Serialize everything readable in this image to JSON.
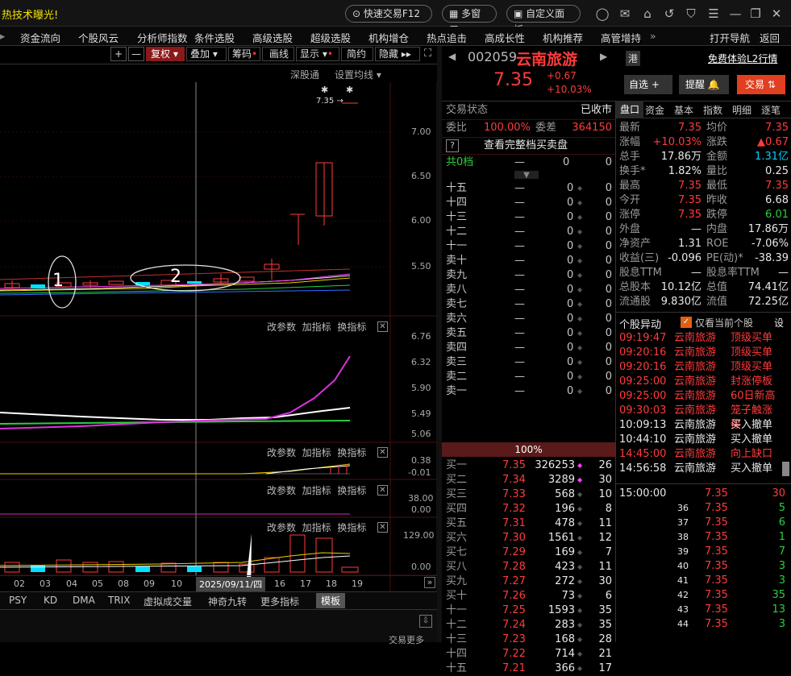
{
  "topbar": {
    "title": "热技术曝光!",
    "buttons": [
      "快速交易F12",
      "多窗口",
      "自定义面板"
    ]
  },
  "menu": [
    "资金流向",
    "个股风云",
    "分析师指数",
    "条件选股",
    "高级选股",
    "超级选股",
    "机构增仓",
    "热点追击",
    "高成长性",
    "机构推荐",
    "高管增持",
    "»",
    "打开导航",
    "返回"
  ],
  "chart_toolbar": [
    "+",
    "—",
    "复权",
    "叠加",
    "筹码",
    "画线",
    "显示",
    "简约",
    "隐藏"
  ],
  "chart_sub": {
    "left": "深股通",
    "right": "设置均线"
  },
  "main_price_marker": "7.35",
  "main_y": [
    "7.00",
    "6.50",
    "6.00",
    "5.50"
  ],
  "annotations": {
    "a1": "1",
    "a2": "2"
  },
  "panel_tools": {
    "change": "改参数",
    "add": "加指标",
    "swap": "换指标"
  },
  "panel2_y": [
    "6.76",
    "6.32",
    "5.90",
    "5.49",
    "5.06"
  ],
  "panel3_y": [
    "0.38",
    "-0.01"
  ],
  "panel4_y": [
    "38.00",
    "0.00"
  ],
  "panel5_y": [
    "129.00",
    "0.00"
  ],
  "x_labels": [
    "02",
    "03",
    "04",
    "05",
    "08",
    "09",
    "10",
    "16",
    "17",
    "18",
    "19"
  ],
  "x_date": "2025/09/11/四",
  "bottom_tabs": [
    "PSY",
    "KD",
    "DMA",
    "TRIX",
    "虚拟成交量",
    "神奇九转",
    "更多指标",
    "模板"
  ],
  "bottom_right": "交易更多",
  "stock": {
    "code": "002059",
    "name": "云南旅游",
    "price": "7.35",
    "change": "+0.67",
    "pct": "+10.03%",
    "tag": "港",
    "l2": "免费体验L2行情"
  },
  "actions": {
    "watch": "自选 +",
    "remind": "提醒",
    "trade": "交易"
  },
  "trade_state": {
    "label": "交易状态",
    "value": "已收市"
  },
  "weibi": {
    "label": "委比",
    "value": "100.00%",
    "label2": "委差",
    "value2": "364150"
  },
  "full_book": "查看完整档买卖盘",
  "gong": {
    "label": "共0档",
    "v1": "—",
    "v2": "0",
    "v3": "0"
  },
  "sell_levels": [
    [
      "十五",
      "—",
      "0",
      "0"
    ],
    [
      "十四",
      "—",
      "0",
      "0"
    ],
    [
      "十三",
      "—",
      "0",
      "0"
    ],
    [
      "十二",
      "—",
      "0",
      "0"
    ],
    [
      "十一",
      "—",
      "0",
      "0"
    ],
    [
      "卖十",
      "—",
      "0",
      "0"
    ],
    [
      "卖九",
      "—",
      "0",
      "0"
    ],
    [
      "卖八",
      "—",
      "0",
      "0"
    ],
    [
      "卖七",
      "—",
      "0",
      "0"
    ],
    [
      "卖六",
      "—",
      "0",
      "0"
    ],
    [
      "卖五",
      "—",
      "0",
      "0"
    ],
    [
      "卖四",
      "—",
      "0",
      "0"
    ],
    [
      "卖三",
      "—",
      "0",
      "0"
    ],
    [
      "卖二",
      "—",
      "0",
      "0"
    ],
    [
      "卖一",
      "—",
      "0",
      "0"
    ]
  ],
  "mid_bar": "100%",
  "buy_levels": [
    [
      "买一",
      "7.35",
      "326253",
      "26"
    ],
    [
      "买二",
      "7.34",
      "3289",
      "30"
    ],
    [
      "买三",
      "7.33",
      "568",
      "10"
    ],
    [
      "买四",
      "7.32",
      "196",
      "8"
    ],
    [
      "买五",
      "7.31",
      "478",
      "11"
    ],
    [
      "买六",
      "7.30",
      "1561",
      "12"
    ],
    [
      "买七",
      "7.29",
      "169",
      "7"
    ],
    [
      "买八",
      "7.28",
      "423",
      "11"
    ],
    [
      "买九",
      "7.27",
      "272",
      "30"
    ],
    [
      "买十",
      "7.26",
      "73",
      "6"
    ],
    [
      "十一",
      "7.25",
      "1593",
      "35"
    ],
    [
      "十二",
      "7.24",
      "283",
      "35"
    ],
    [
      "十三",
      "7.23",
      "168",
      "28"
    ],
    [
      "十四",
      "7.22",
      "714",
      "21"
    ],
    [
      "十五",
      "7.21",
      "366",
      "17"
    ]
  ],
  "tabs": [
    "盘口",
    "资金",
    "基本",
    "指数",
    "明细",
    "逐笔"
  ],
  "quote": [
    [
      "最新",
      "7.35",
      "均价",
      "7.35"
    ],
    [
      "涨幅",
      "+10.03%",
      "涨跌",
      "▲0.67"
    ],
    [
      "总手",
      "17.86万",
      "金额",
      "1.31亿"
    ],
    [
      "换手*",
      "1.82%",
      "量比",
      "0.25"
    ],
    [
      "最高",
      "7.35",
      "最低",
      "7.35"
    ],
    [
      "今开",
      "7.35",
      "昨收",
      "6.68"
    ],
    [
      "涨停",
      "7.35",
      "跌停",
      "6.01"
    ],
    [
      "外盘",
      "—",
      "内盘",
      "17.86万"
    ],
    [
      "净资产",
      "1.31",
      "ROE",
      "-7.06%"
    ],
    [
      "收益(三)",
      "-0.096",
      "PE(动)*",
      "-38.39"
    ],
    [
      "股息TTM",
      "—",
      "股息率TTM",
      "—"
    ],
    [
      "总股本",
      "10.12亿",
      "总值",
      "74.41亿"
    ],
    [
      "流通股",
      "9.830亿",
      "流值",
      "72.25亿"
    ]
  ],
  "yidong": {
    "title": "个股异动",
    "check": "仅看当前个股",
    "set": "设"
  },
  "events": [
    [
      "09:19:47",
      "云南旅游",
      "顶级买单"
    ],
    [
      "09:20:16",
      "云南旅游",
      "顶级买单"
    ],
    [
      "09:20:16",
      "云南旅游",
      "顶级买单"
    ],
    [
      "09:25:00",
      "云南旅游",
      "封涨停板"
    ],
    [
      "09:25:00",
      "云南旅游",
      "60日新高"
    ],
    [
      "09:30:03",
      "云南旅游",
      "笼子触涨停"
    ],
    [
      "10:09:13",
      "云南旅游",
      "买入撤单"
    ],
    [
      "10:44:10",
      "云南旅游",
      "买入撤单"
    ],
    [
      "14:45:00",
      "云南旅游",
      "向上缺口"
    ],
    [
      "14:56:58",
      "云南旅游",
      "买入撤单"
    ]
  ],
  "ticks": [
    [
      "15:00:00",
      "7.35",
      "30"
    ],
    [
      "36",
      "7.35",
      "5"
    ],
    [
      "37",
      "7.35",
      "6"
    ],
    [
      "38",
      "7.35",
      "1"
    ],
    [
      "39",
      "7.35",
      "7"
    ],
    [
      "40",
      "7.35",
      "3"
    ],
    [
      "41",
      "7.35",
      "3"
    ],
    [
      "42",
      "7.35",
      "35"
    ],
    [
      "43",
      "7.35",
      "13"
    ],
    [
      "44",
      "7.35",
      "3"
    ]
  ]
}
